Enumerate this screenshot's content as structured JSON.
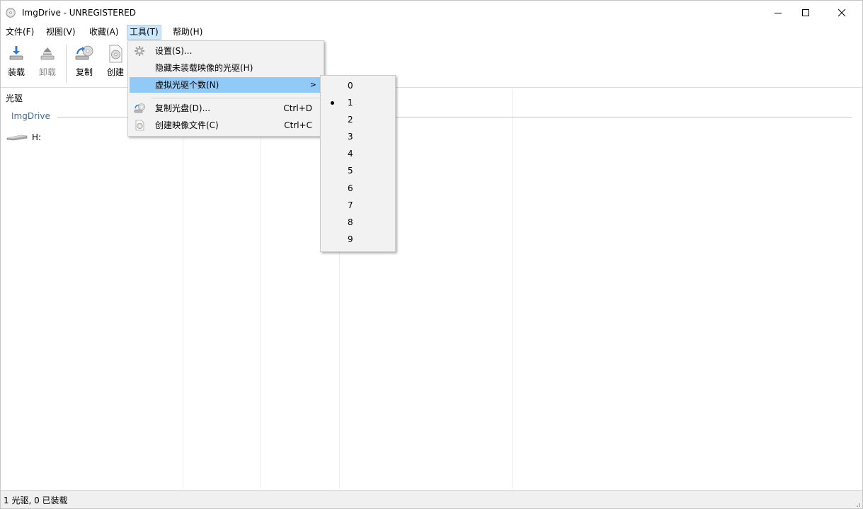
{
  "window": {
    "title": "ImgDrive - UNREGISTERED"
  },
  "menubar": {
    "items": [
      "文件(F)",
      "视图(V)",
      "收藏(A)",
      "工具(T)",
      "帮助(H)"
    ],
    "active_index": 3
  },
  "toolbar": {
    "mount_label": "装载",
    "unmount_label": "卸载",
    "copy_label": "复制",
    "create_label": "创建"
  },
  "list": {
    "column_header": "光驱",
    "group_label": "ImgDrive",
    "drive_label": "H:"
  },
  "tools_menu": {
    "settings": "设置(S)...",
    "hide_unmounted": "隐藏未装载映像的光驱(H)",
    "virtual_drive_count": "虚拟光驱个数(N)",
    "copy_disc": "复制光盘(D)...",
    "copy_disc_shortcut": "Ctrl+D",
    "create_image": "创建映像文件(C)",
    "create_image_shortcut": "Ctrl+C",
    "submenu_arrow": ">"
  },
  "drive_count_submenu": {
    "options": [
      "0",
      "1",
      "2",
      "3",
      "4",
      "5",
      "6",
      "7",
      "8",
      "9"
    ],
    "selected": "1"
  },
  "statusbar": {
    "text": "1 光驱, 0 已装载"
  },
  "icons": {
    "app": "disc-icon",
    "mount": "mount-down-arrow-icon",
    "unmount": "eject-icon",
    "copy": "copy-disc-icon",
    "create": "create-image-icon",
    "settings": "gear-icon",
    "drive": "optical-drive-icon"
  }
}
